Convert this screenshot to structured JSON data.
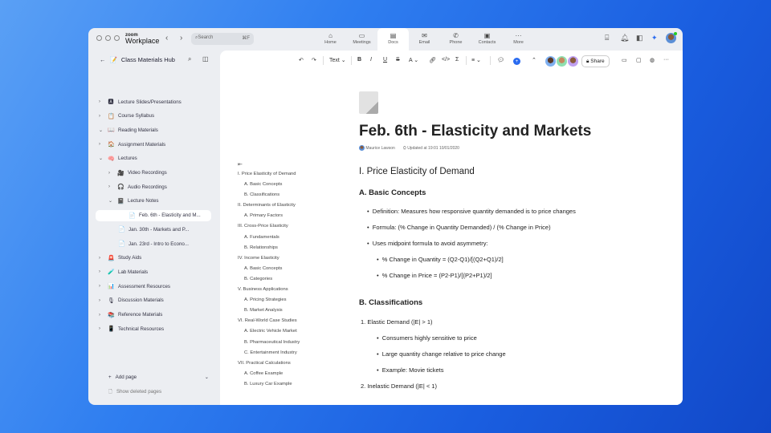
{
  "app": {
    "logo_small": "zoom",
    "logo_big": "Workplace",
    "search_placeholder": "Search",
    "search_shortcut": "⌘F"
  },
  "tabs": [
    {
      "label": "Home",
      "icon": "⌂"
    },
    {
      "label": "Meetings",
      "icon": "▭"
    },
    {
      "label": "Docs",
      "icon": "▤",
      "active": true
    },
    {
      "label": "Email",
      "icon": "✉"
    },
    {
      "label": "Phone",
      "icon": "✆"
    },
    {
      "label": "Contacts",
      "icon": "▣"
    },
    {
      "label": "More",
      "icon": "···"
    }
  ],
  "sidebar": {
    "title": "Class Materials Hub",
    "items": [
      {
        "label": "Lecture Slides/Presentations",
        "emoji": "🅰",
        "chev": "›"
      },
      {
        "label": "Course Syllabus",
        "emoji": "📋",
        "chev": "›"
      },
      {
        "label": "Reading Materials",
        "emoji": "📖",
        "chev": "⌄"
      },
      {
        "label": "Assignment Materials",
        "emoji": "🏠",
        "chev": "›"
      },
      {
        "label": "Lectures",
        "emoji": "🧠",
        "chev": "⌄"
      },
      {
        "label": "Video Recordings",
        "emoji": "🎥",
        "chev": "›"
      },
      {
        "label": "Audio Recordings",
        "emoji": "🎧",
        "chev": "›"
      },
      {
        "label": "Lecture Notes",
        "emoji": "📓",
        "chev": "⌄"
      },
      {
        "label": "Feb. 6th - Elasticity and M...",
        "emoji": "📄",
        "chev": ""
      },
      {
        "label": "Jan. 30th - Markets and P...",
        "emoji": "📄",
        "chev": ""
      },
      {
        "label": "Jan. 23rd - Intro to Econo...",
        "emoji": "📄",
        "chev": ""
      },
      {
        "label": "Study Aids",
        "emoji": "🚨",
        "chev": "›"
      },
      {
        "label": "Lab Materials",
        "emoji": "🧪",
        "chev": "›"
      },
      {
        "label": "Assessment Resources",
        "emoji": "📊",
        "chev": "›"
      },
      {
        "label": "Discussion Materials",
        "emoji": "🎙",
        "chev": "›"
      },
      {
        "label": "Reference Materials",
        "emoji": "📚",
        "chev": "›"
      },
      {
        "label": "Technical Resources",
        "emoji": "📱",
        "chev": "›"
      }
    ],
    "add_page": "Add page",
    "show_deleted": "Show deleted pages"
  },
  "toolbar": {
    "text_style": "Text",
    "share": "Share"
  },
  "toc": [
    {
      "t": "I. Price Elasticity of Demand",
      "l": 1
    },
    {
      "t": "A. Basic Concepts",
      "l": 2
    },
    {
      "t": "B. Classifications",
      "l": 2
    },
    {
      "t": "II. Determinants of Elasticity",
      "l": 1
    },
    {
      "t": "A. Primary Factors",
      "l": 2
    },
    {
      "t": "III. Cross-Price Elasticity",
      "l": 1
    },
    {
      "t": "A. Fundamentals",
      "l": 2
    },
    {
      "t": "B. Relationships",
      "l": 2
    },
    {
      "t": "IV. Income Elasticity",
      "l": 1
    },
    {
      "t": "A. Basic Concepts",
      "l": 2
    },
    {
      "t": "B. Categories",
      "l": 2
    },
    {
      "t": "V. Business Applications",
      "l": 1
    },
    {
      "t": "A. Pricing Strategies",
      "l": 2
    },
    {
      "t": "B. Market Analysis",
      "l": 2
    },
    {
      "t": "VI. Real-World Case Studies",
      "l": 1
    },
    {
      "t": "A. Electric Vehicle Market",
      "l": 2
    },
    {
      "t": "B. Pharmaceutical Industry",
      "l": 2
    },
    {
      "t": "C. Entertainment Industry",
      "l": 2
    },
    {
      "t": "VII. Practical Calculations",
      "l": 1
    },
    {
      "t": "A. Coffee Example",
      "l": 2
    },
    {
      "t": "B. Luxury Car Example",
      "l": 2
    }
  ],
  "doc": {
    "title": "Feb. 6th - Elasticity and Markets",
    "author": "Maurice Lawson",
    "updated": "Updated at 19:01 10/01/2020",
    "h2_1": "I. Price Elasticity of Demand",
    "h3_1": "A. Basic Concepts",
    "b1": "Definition: Measures how responsive quantity demanded is to price changes",
    "b2": "Formula: (% Change in Quantity Demanded) / (% Change in Price)",
    "b3": "Uses midpoint formula to avoid asymmetry:",
    "b3a": "% Change in Quantity = (Q2-Q1)/[(Q2+Q1)/2]",
    "b3b": "% Change in Price = (P2-P1)/[(P2+P1)/2]",
    "h3_2": "B. Classifications",
    "n1": "1. Elastic Demand (|E| > 1)",
    "n1a": "Consumers highly sensitive to price",
    "n1b": "Large quantity change relative to price change",
    "n1c": "Example: Movie tickets",
    "n2": "2. Inelastic Demand (|E| < 1)"
  }
}
